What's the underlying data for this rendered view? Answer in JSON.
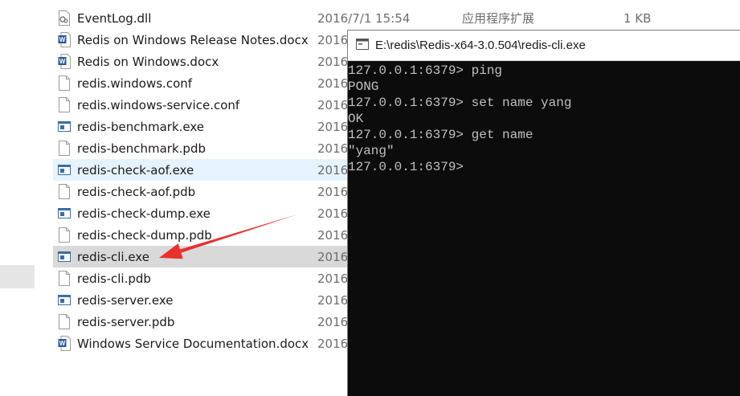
{
  "files": [
    {
      "name": "EventLog.dll",
      "date": "2016/7/1 15:54",
      "type": "应用程序扩展",
      "size": "1 KB",
      "icon": "dll-file-icon",
      "state": ""
    },
    {
      "name": "Redis on Windows Release Notes.docx",
      "date": "2016",
      "type": "",
      "size": "",
      "icon": "word-document-icon",
      "state": ""
    },
    {
      "name": "Redis on Windows.docx",
      "date": "2016",
      "type": "",
      "size": "",
      "icon": "word-document-icon",
      "state": ""
    },
    {
      "name": "redis.windows.conf",
      "date": "2016",
      "type": "",
      "size": "",
      "icon": "blank-file-icon",
      "state": ""
    },
    {
      "name": "redis.windows-service.conf",
      "date": "2016",
      "type": "",
      "size": "",
      "icon": "blank-file-icon",
      "state": ""
    },
    {
      "name": "redis-benchmark.exe",
      "date": "2016",
      "type": "",
      "size": "",
      "icon": "exe-file-icon",
      "state": ""
    },
    {
      "name": "redis-benchmark.pdb",
      "date": "2016",
      "type": "",
      "size": "",
      "icon": "blank-file-icon",
      "state": ""
    },
    {
      "name": "redis-check-aof.exe",
      "date": "2016",
      "type": "",
      "size": "",
      "icon": "exe-file-icon",
      "state": "hover"
    },
    {
      "name": "redis-check-aof.pdb",
      "date": "2016",
      "type": "",
      "size": "",
      "icon": "blank-file-icon",
      "state": ""
    },
    {
      "name": "redis-check-dump.exe",
      "date": "2016",
      "type": "",
      "size": "",
      "icon": "exe-file-icon",
      "state": ""
    },
    {
      "name": "redis-check-dump.pdb",
      "date": "2016",
      "type": "",
      "size": "",
      "icon": "blank-file-icon",
      "state": ""
    },
    {
      "name": "redis-cli.exe",
      "date": "2016",
      "type": "",
      "size": "",
      "icon": "exe-file-icon",
      "state": "selected"
    },
    {
      "name": "redis-cli.pdb",
      "date": "2016",
      "type": "",
      "size": "",
      "icon": "blank-file-icon",
      "state": ""
    },
    {
      "name": "redis-server.exe",
      "date": "2016",
      "type": "",
      "size": "",
      "icon": "exe-file-icon",
      "state": ""
    },
    {
      "name": "redis-server.pdb",
      "date": "2016",
      "type": "",
      "size": "",
      "icon": "blank-file-icon",
      "state": ""
    },
    {
      "name": "Windows Service Documentation.docx",
      "date": "2016",
      "type": "",
      "size": "",
      "icon": "word-document-icon",
      "state": ""
    }
  ],
  "console": {
    "title": "E:\\redis\\Redis-x64-3.0.504\\redis-cli.exe",
    "lines": [
      "127.0.0.1:6379> ping",
      "PONG",
      "127.0.0.1:6379> set name yang",
      "OK",
      "127.0.0.1:6379> get name",
      "\"yang\"",
      "127.0.0.1:6379>"
    ]
  },
  "colors": {
    "annotation_arrow": "#e8322d",
    "console_bg": "#0c0c0c",
    "console_text": "#c0c0c0",
    "row_hover": "#e5f3ff",
    "row_selected": "#d9d9d9"
  }
}
